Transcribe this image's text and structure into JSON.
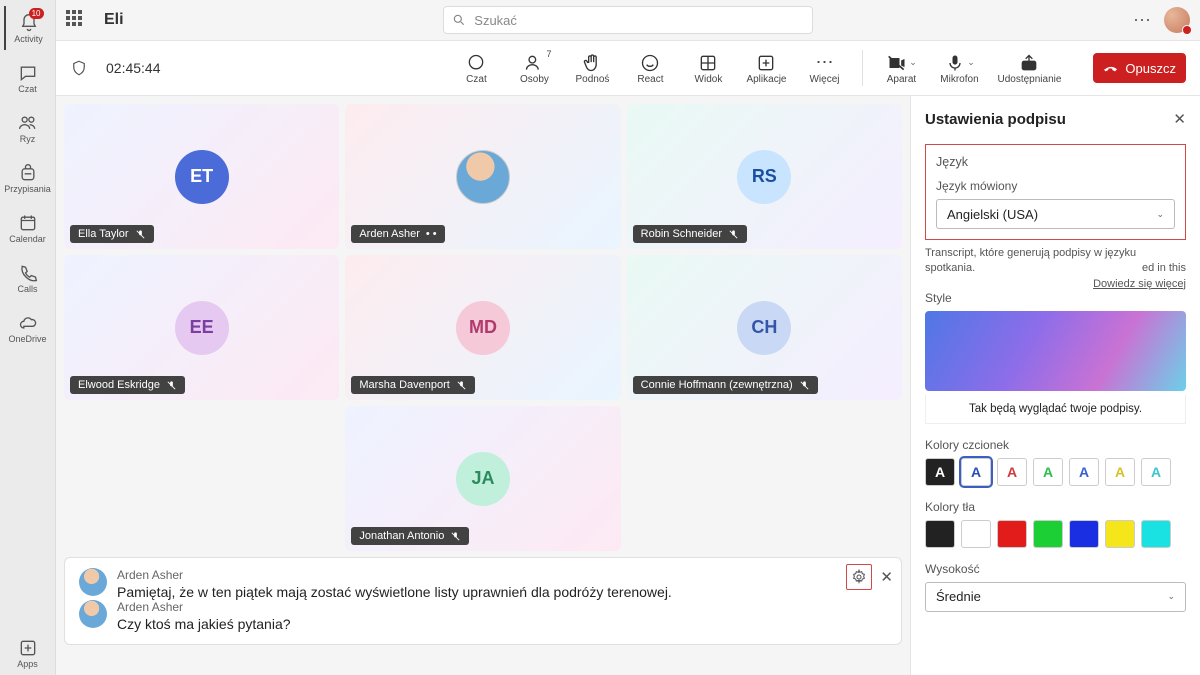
{
  "app_title": "Eli",
  "search_placeholder": "Szukać",
  "rail": [
    {
      "label": "Activity",
      "badge": "10"
    },
    {
      "label": "Czat"
    },
    {
      "label": "Ryz"
    },
    {
      "label": "Przypisania"
    },
    {
      "label": "Calendar"
    },
    {
      "label": "Calls"
    },
    {
      "label": "OneDrive"
    }
  ],
  "rail_apps": "Apps",
  "meeting": {
    "timer": "02:45:44",
    "buttons": {
      "chat": "Czat",
      "people": "Osoby",
      "people_count": "7",
      "raise": "Podnoś",
      "react": "React",
      "view": "Widok",
      "apps": "Aplikacje",
      "more": "Więcej",
      "camera": "Aparat",
      "mic": "Mikrofon",
      "share": "Udostępnianie",
      "leave": "Opuszcz"
    }
  },
  "tiles": [
    {
      "initials": "ET",
      "name": "Ella Taylor",
      "bg": "#4a6bd8",
      "fg": "#fff",
      "photo": false
    },
    {
      "initials": "",
      "name": "Arden Asher",
      "photo": true,
      "dots": true
    },
    {
      "initials": "RS",
      "name": "Robin Schneider",
      "bg": "#c9e4ff",
      "fg": "#1b4ea3",
      "photo": false
    },
    {
      "initials": "EE",
      "name": "Elwood Eskridge",
      "bg": "#e6c9f0",
      "fg": "#7a3fa0",
      "photo": false
    },
    {
      "initials": "MD",
      "name": "Marsha Davenport",
      "bg": "#f5c9d8",
      "fg": "#b03a6e",
      "photo": false
    },
    {
      "initials": "CH",
      "name": "Connie Hoffmann (zewnętrzna)",
      "bg": "#c9d9f5",
      "fg": "#3556a8",
      "photo": false
    },
    {
      "initials": "JA",
      "name": "Jonathan Antonio",
      "bg": "#c0efdb",
      "fg": "#2d8a5f",
      "photo": false
    }
  ],
  "captions": [
    {
      "speaker": "Arden Asher",
      "text": "Pamiętaj, że w ten piątek mają zostać wyświetlone listy uprawnień dla podróży terenowej."
    },
    {
      "speaker": "Arden Asher",
      "text": "Czy ktoś ma jakieś pytania?"
    }
  ],
  "panel": {
    "title": "Ustawienia podpisu",
    "lang_section": "Język",
    "spoken_label": "Język mówiony",
    "spoken_value": "Angielski (USA)",
    "hint_main": "Transcript, które generują podpisy w języku spotkania.",
    "hint_extra": "ed in this",
    "hint_link": "Dowiedz się więcej",
    "style_label": "Style",
    "preview_caption": "Tak będą wyglądać twoje podpisy.",
    "font_colors_label": "Kolory czcionek",
    "font_colors": [
      {
        "letter": "A",
        "fg": "#fff",
        "bg": "#222"
      },
      {
        "letter": "A",
        "fg": "#2b4db5",
        "bg": "#fff",
        "sel": true
      },
      {
        "letter": "A",
        "fg": "#d13a3a",
        "bg": "#fff"
      },
      {
        "letter": "A",
        "fg": "#2abf4a",
        "bg": "#fff"
      },
      {
        "letter": "A",
        "fg": "#3a5fd1",
        "bg": "#fff"
      },
      {
        "letter": "A",
        "fg": "#d6c32a",
        "bg": "#fff"
      },
      {
        "letter": "A",
        "fg": "#3ac7d1",
        "bg": "#fff"
      }
    ],
    "bg_colors_label": "Kolory tła",
    "bg_colors": [
      "#222",
      "#fff",
      "#e21b1b",
      "#1bcf34",
      "#1b2fe2",
      "#f5e51b",
      "#1be2e2"
    ],
    "height_label": "Wysokość",
    "height_value": "Średnie"
  }
}
